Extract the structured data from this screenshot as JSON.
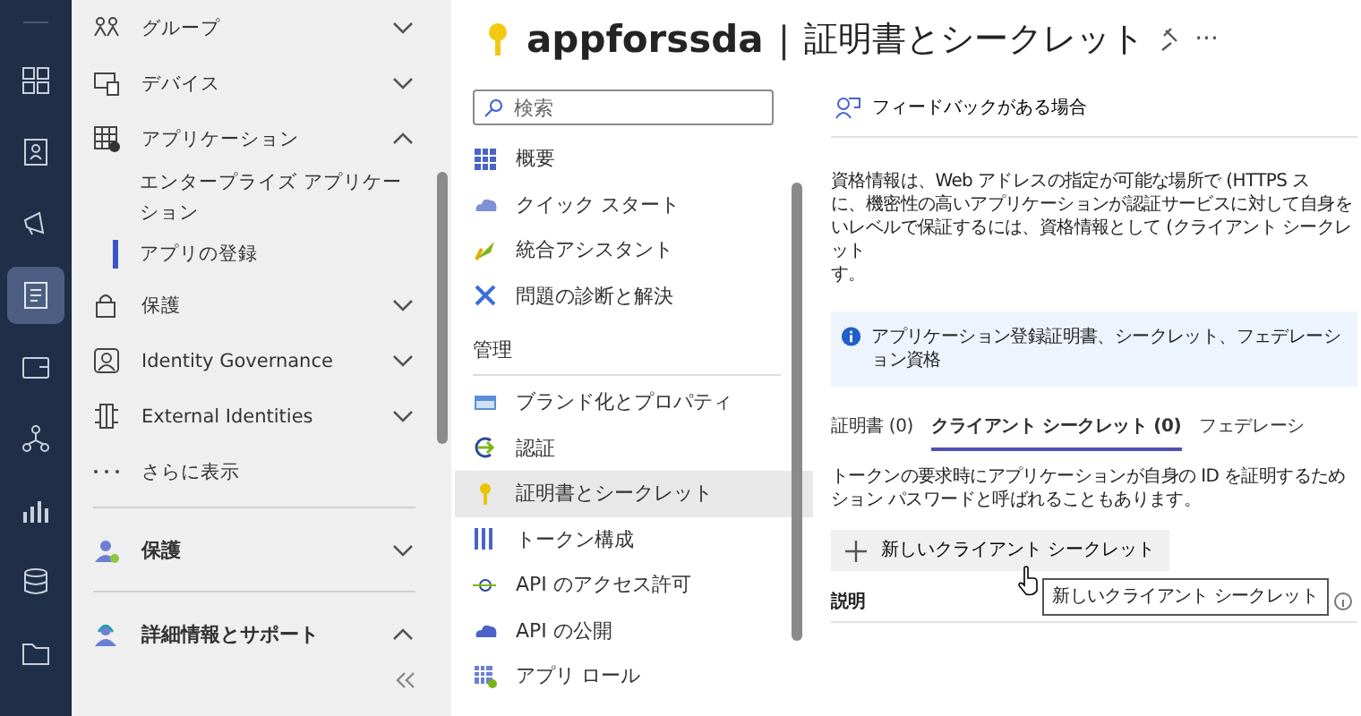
{
  "rail": {
    "items": [
      {
        "selected": false
      },
      {
        "selected": false
      },
      {
        "selected": false
      },
      {
        "selected": true
      },
      {
        "selected": false
      },
      {
        "selected": false
      },
      {
        "selected": false
      },
      {
        "selected": false
      },
      {
        "selected": false
      }
    ]
  },
  "nav": {
    "items": [
      {
        "kind": "group",
        "label": "グループ",
        "expanded": false
      },
      {
        "kind": "group",
        "label": "デバイス",
        "expanded": false
      },
      {
        "kind": "group",
        "label": "アプリケーション",
        "expanded": true,
        "children": [
          {
            "label": "エンタープライズ アプリケーション",
            "selected": false
          },
          {
            "label": "アプリの登録",
            "selected": true
          }
        ]
      },
      {
        "kind": "group",
        "label": "保護",
        "expanded": false
      },
      {
        "kind": "group",
        "label": "Identity Governance",
        "expanded": false
      },
      {
        "kind": "group",
        "label": "External Identities",
        "expanded": false
      },
      {
        "kind": "more",
        "label": "さらに表示"
      }
    ],
    "sections": [
      {
        "label": "保護",
        "expanded": false
      },
      {
        "label": "詳細情報とサポート",
        "expanded": true
      }
    ]
  },
  "blade": {
    "app_name": "appforssda",
    "separator": "|",
    "title": "証明書とシークレット",
    "more": "···"
  },
  "menu": {
    "search": {
      "placeholder": "検索"
    },
    "groups": [
      {
        "items": [
          {
            "label": "概要",
            "selected": false
          },
          {
            "label": "クイック スタート",
            "selected": false
          },
          {
            "label": "統合アシスタント",
            "selected": false
          },
          {
            "label": "問題の診断と解決",
            "selected": false
          }
        ]
      },
      {
        "heading": "管理",
        "items": [
          {
            "label": "ブランド化とプロパティ",
            "selected": false
          },
          {
            "label": "認証",
            "selected": false
          },
          {
            "label": "証明書とシークレット",
            "selected": true
          },
          {
            "label": "トークン構成",
            "selected": false
          },
          {
            "label": "API のアクセス許可",
            "selected": false
          },
          {
            "label": "API の公開",
            "selected": false
          },
          {
            "label": "アプリ ロール",
            "selected": false
          }
        ]
      }
    ]
  },
  "content": {
    "feedback": "フィードバックがある場合",
    "paragraph_lines": [
      "資格情報は、Web アドレスの指定が可能な場所で (HTTPS ス",
      "に、機密性の高いアプリケーションが認証サービスに対して自身を",
      "いレベルで保証するには、資格情報として (クライアント シークレット",
      "す。"
    ],
    "info": "アプリケーション登録証明書、シークレット、フェデレーション資格",
    "tabs": [
      {
        "label": "証明書 (0)",
        "selected": false
      },
      {
        "label": "クライアント シークレット (0)",
        "selected": true
      },
      {
        "label": "フェデレーシ",
        "selected": false
      }
    ],
    "tab_description_lines": [
      "トークンの要求時にアプリケーションが自身の ID を証明するため",
      "ション パスワードと呼ばれることもあります。"
    ],
    "new_button": "新しいクライアント シークレット",
    "columns": [
      "説明"
    ],
    "tooltip": "新しいクライアント シークレット"
  }
}
